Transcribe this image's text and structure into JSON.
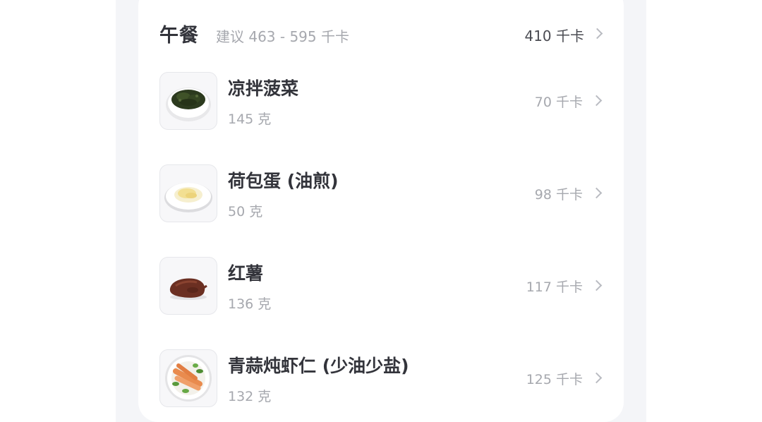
{
  "meal": {
    "title": "午餐",
    "suggestion": "建议 463 - 595 千卡",
    "total": "410 千卡"
  },
  "foods": [
    {
      "name": "凉拌菠菜",
      "weight": "145 克",
      "calories": "70 千卡",
      "icon": "spinach-dish-icon"
    },
    {
      "name": "荷包蛋 (油煎)",
      "weight": "50 克",
      "calories": "98 千卡",
      "icon": "fried-egg-icon"
    },
    {
      "name": "红薯",
      "weight": "136 克",
      "calories": "117 千卡",
      "icon": "sweet-potato-icon"
    },
    {
      "name": "青蒜炖虾仁 (少油少盐)",
      "weight": "132 克",
      "calories": "125 千卡",
      "icon": "shrimp-dish-icon"
    }
  ],
  "colors": {
    "primary_text": "#33343b",
    "secondary_text": "#a6a8ae",
    "background": "#f4f5f8",
    "card": "#ffffff"
  }
}
